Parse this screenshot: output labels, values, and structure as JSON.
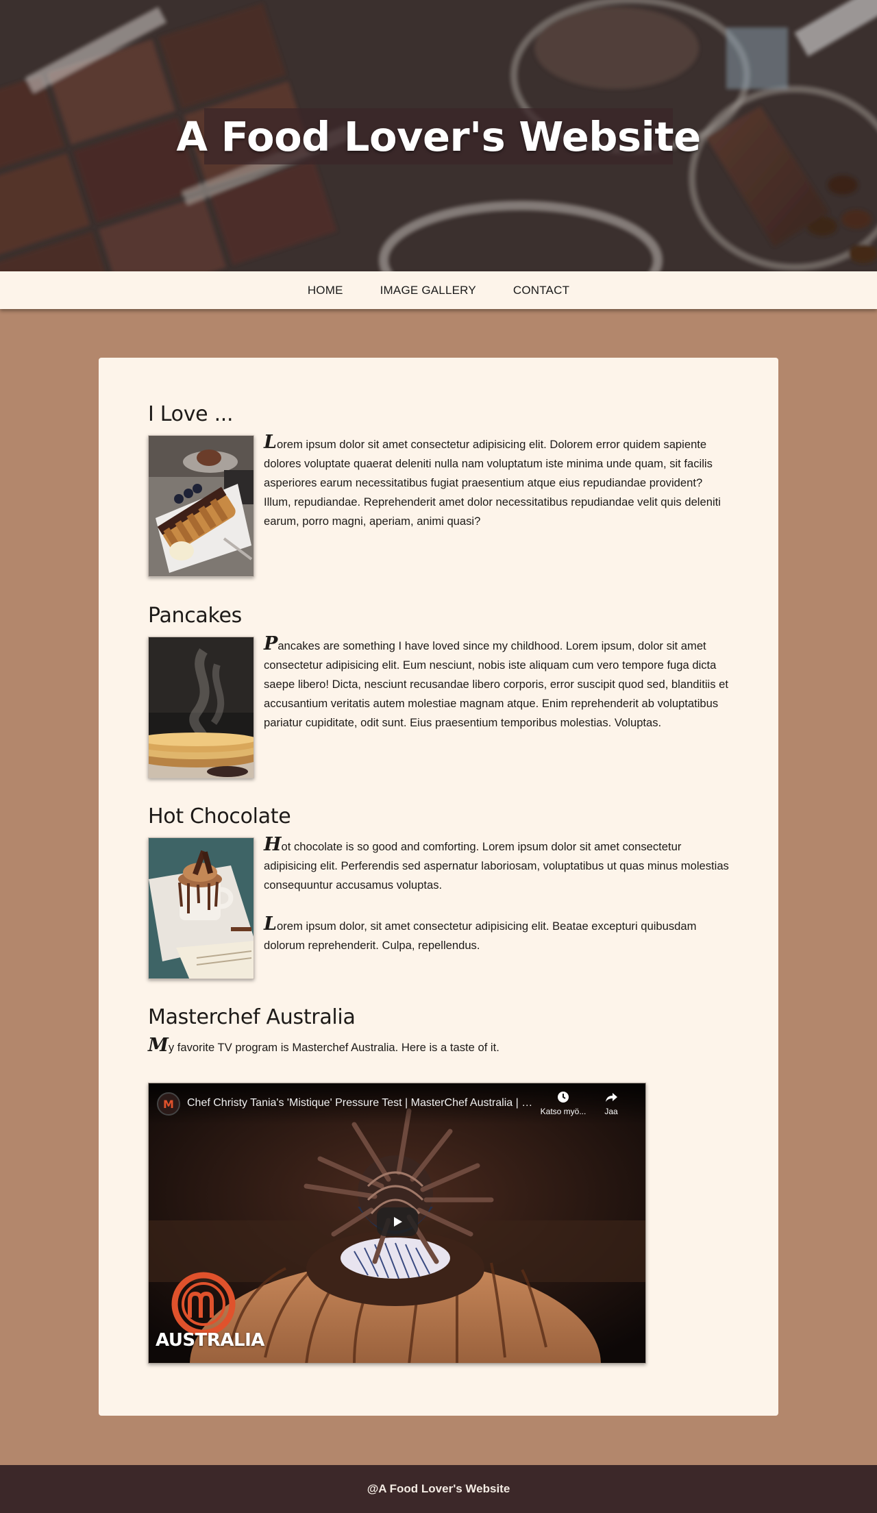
{
  "site": {
    "title": "A Food Lover's Website"
  },
  "nav": {
    "items": [
      {
        "label": "HOME"
      },
      {
        "label": "IMAGE GALLERY"
      },
      {
        "label": "CONTACT"
      }
    ]
  },
  "sections": [
    {
      "heading": "I Love ...",
      "paragraphs": [
        {
          "cap": "L",
          "rest": "orem ipsum dolor sit amet consectetur adipisicing elit. Dolorem error quidem sapiente dolores voluptate quaerat deleniti nulla nam voluptatum iste minima unde quam, sit facilis asperiores earum necessitatibus fugiat praesentium atque eius repudiandae provident? Illum, repudiandae. Reprehenderit amet dolor necessitatibus repudiandae velit quis deleniti earum, porro magni, aperiam, animi quasi?"
        }
      ]
    },
    {
      "heading": "Pancakes",
      "paragraphs": [
        {
          "cap": "P",
          "rest": "ancakes are something I have loved since my childhood. Lorem ipsum, dolor sit amet consectetur adipisicing elit. Eum nesciunt, nobis iste aliquam cum vero tempore fuga dicta saepe libero! Dicta, nesciunt recusandae libero corporis, error suscipit quod sed, blanditiis et accusantium veritatis autem molestiae magnam atque. Enim reprehenderit ab voluptatibus pariatur cupiditate, odit sunt. Eius praesentium temporibus molestias. Voluptas."
        }
      ]
    },
    {
      "heading": "Hot Chocolate",
      "paragraphs": [
        {
          "cap": "H",
          "rest": "ot chocolate is so good and comforting. Lorem ipsum dolor sit amet consectetur adipisicing elit. Perferendis sed aspernatur laboriosam, voluptatibus ut quas minus molestias consequuntur accusamus voluptas."
        },
        {
          "cap": "L",
          "rest": "orem ipsum dolor, sit amet consectetur adipisicing elit. Beatae excepturi quibusdam dolorum reprehenderit. Culpa, repellendus."
        }
      ]
    },
    {
      "heading": "Masterchef Australia",
      "paragraphs": [
        {
          "cap": "M",
          "rest": "y favorite TV program is Masterchef Australia. Here is a taste of it."
        }
      ]
    }
  ],
  "video": {
    "title": "Chef Christy Tania's 'Mistique' Pressure Test | MasterChef Australia | MasterChef World",
    "watch_later_label": "Katso myö...",
    "share_label": "Jaa",
    "overlay_text": "AUSTRALIA",
    "brand_color": "#e0522c",
    "icons": {
      "channel": "masterchef-channel-icon",
      "watch_later": "clock-icon",
      "share": "share-icon",
      "play": "play-icon"
    }
  },
  "footer": {
    "text": "@A Food Lover's Website"
  },
  "colors": {
    "page_background": "#b3876c",
    "card_background": "#fdf4ea",
    "footer_background": "#3c2829"
  }
}
